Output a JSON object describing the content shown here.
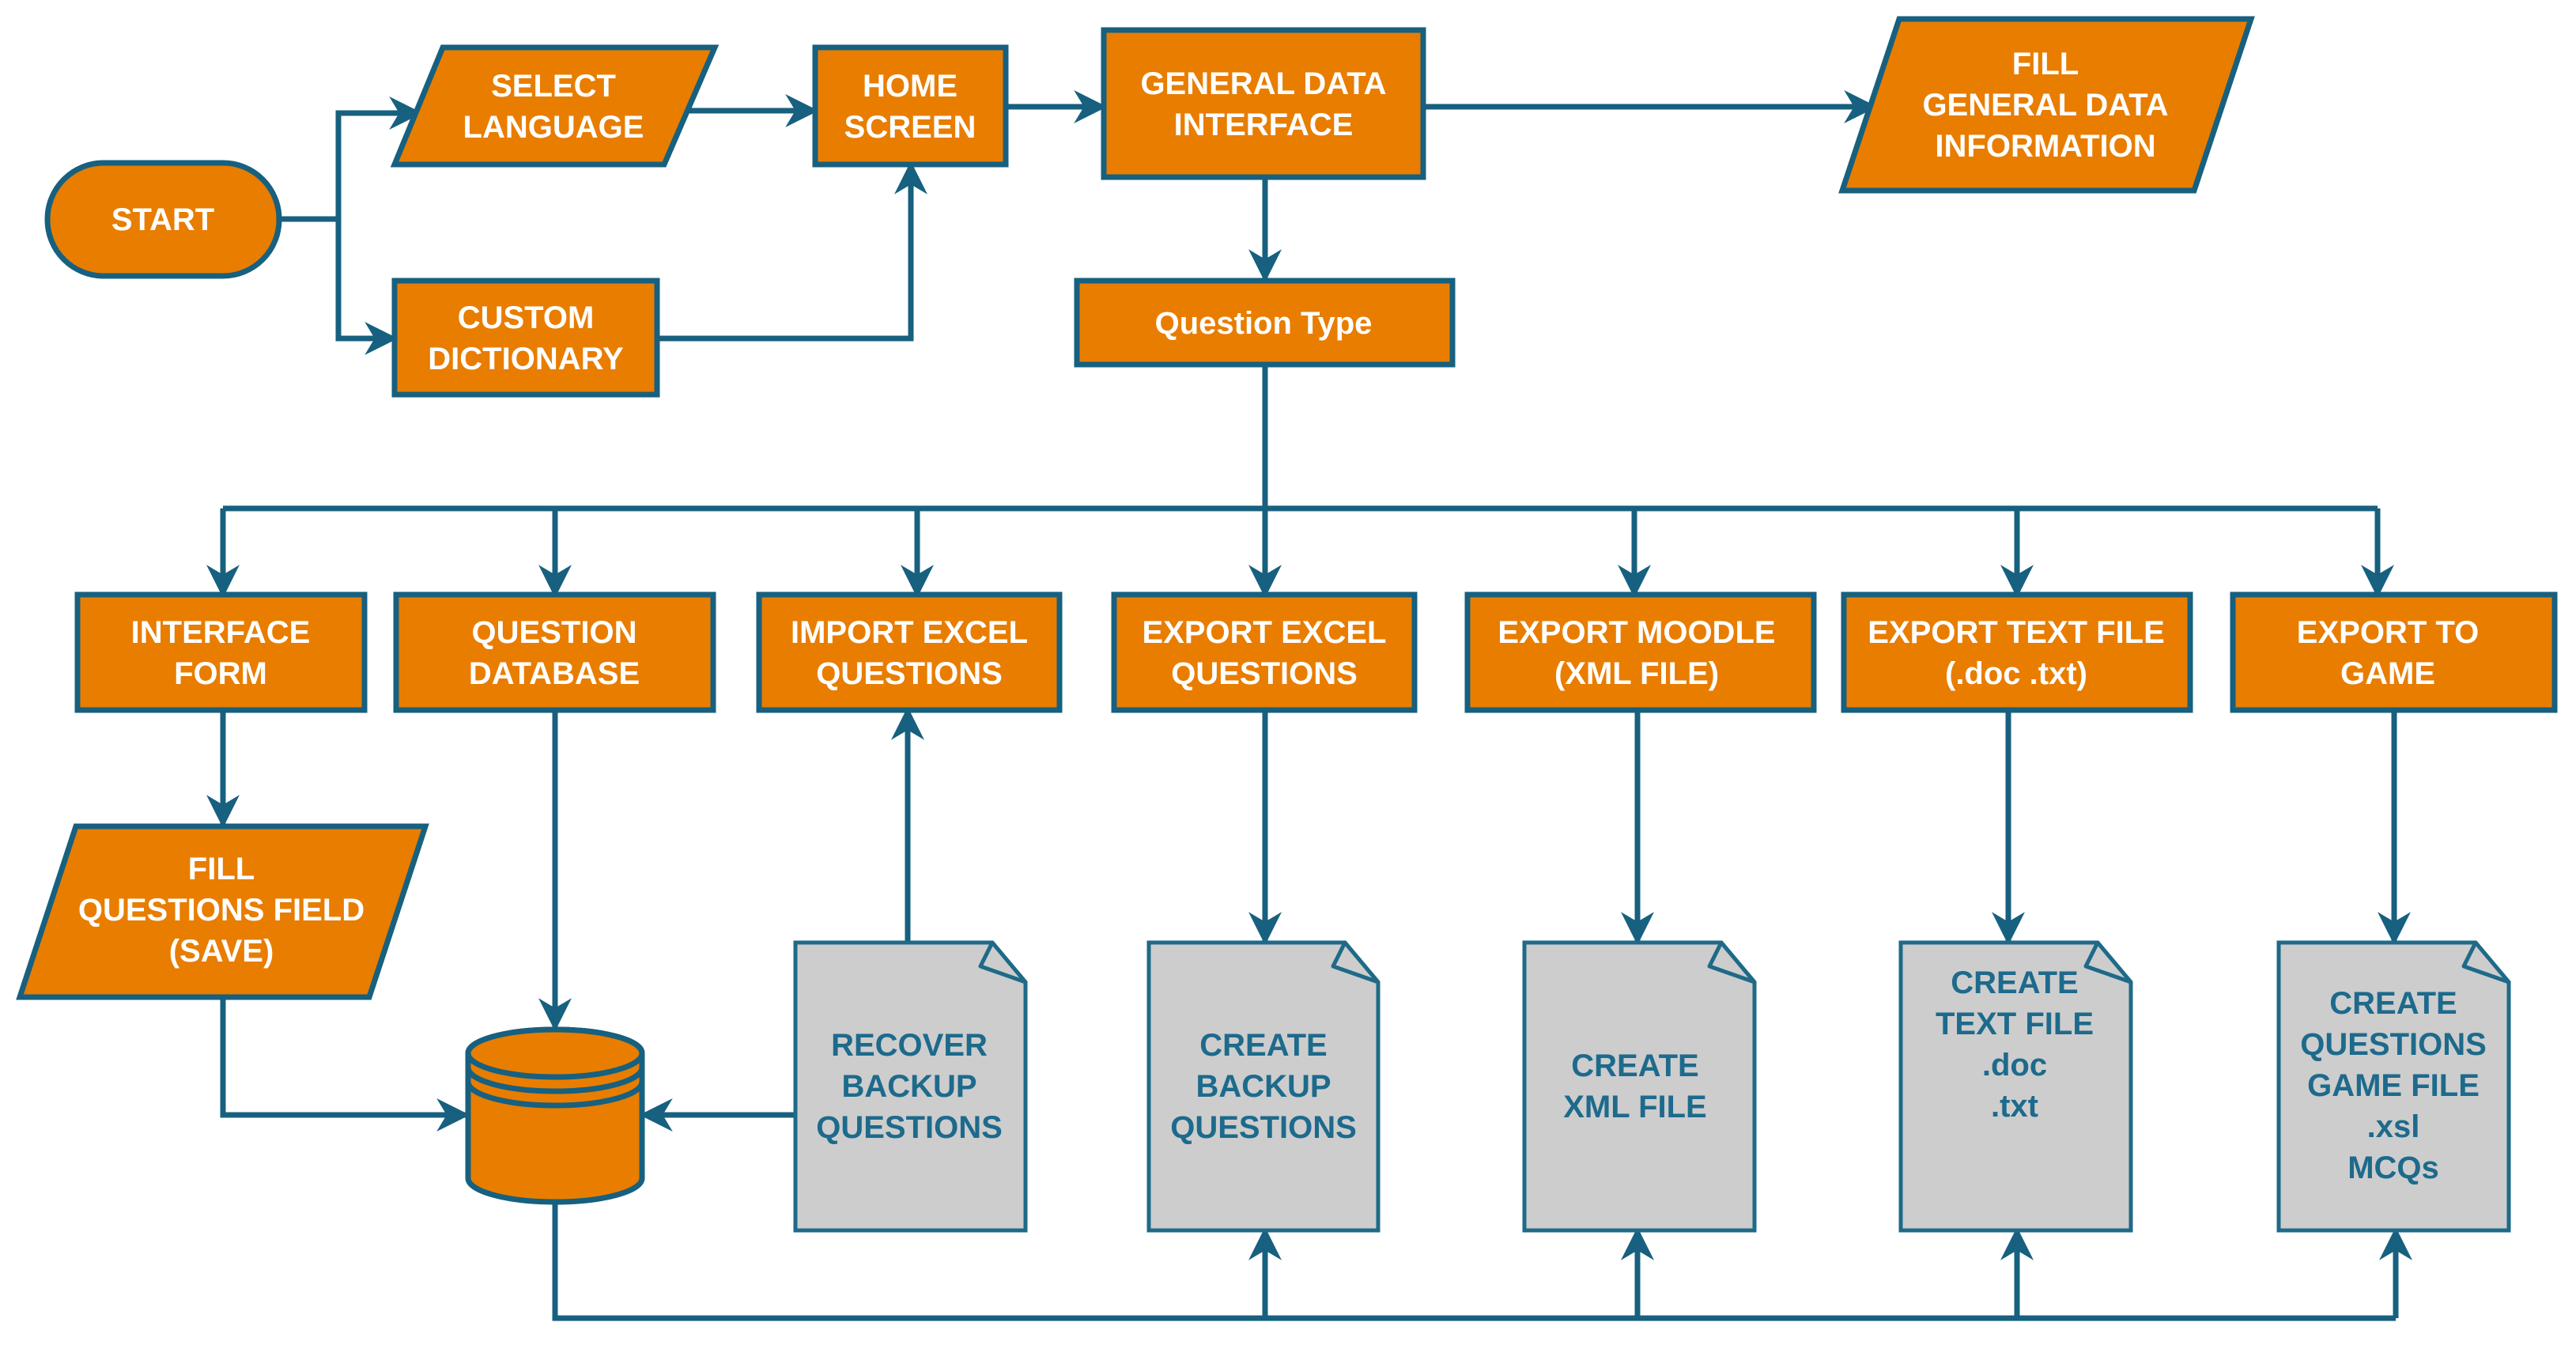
{
  "colors": {
    "process_fill": "#E87D00",
    "outline": "#17607F",
    "document_fill": "#CDCDCD",
    "document_text": "#1D6A8C",
    "process_text": "#FFFFFF"
  },
  "nodes": {
    "start": {
      "shape": "terminator",
      "lines": [
        "START"
      ]
    },
    "select_language": {
      "shape": "input-output",
      "lines": [
        "SELECT",
        "LANGUAGE"
      ]
    },
    "custom_dictionary": {
      "shape": "process",
      "lines": [
        "CUSTOM",
        "DICTIONARY"
      ]
    },
    "home_screen": {
      "shape": "process",
      "lines": [
        "HOME",
        "SCREEN"
      ]
    },
    "general_data_interface": {
      "shape": "process",
      "lines": [
        "GENERAL DATA",
        "INTERFACE"
      ]
    },
    "fill_general_data": {
      "shape": "input-output",
      "lines": [
        "FILL",
        "GENERAL DATA",
        "INFORMATION"
      ]
    },
    "question_type": {
      "shape": "process",
      "lines": [
        "Question Type"
      ]
    },
    "interface_form": {
      "shape": "process",
      "lines": [
        "INTERFACE",
        "FORM"
      ]
    },
    "question_database": {
      "shape": "process",
      "lines": [
        "QUESTION",
        "DATABASE"
      ]
    },
    "import_excel": {
      "shape": "process",
      "lines": [
        "IMPORT EXCEL",
        "QUESTIONS"
      ]
    },
    "export_excel": {
      "shape": "process",
      "lines": [
        "EXPORT EXCEL",
        "QUESTIONS"
      ]
    },
    "export_moodle": {
      "shape": "process",
      "lines": [
        "EXPORT MOODLE",
        "(XML FILE)"
      ]
    },
    "export_text": {
      "shape": "process",
      "lines": [
        "EXPORT TEXT FILE",
        "(.doc .txt)"
      ]
    },
    "export_game": {
      "shape": "process",
      "lines": [
        "EXPORT TO",
        "GAME"
      ]
    },
    "fill_questions_field": {
      "shape": "input-output",
      "lines": [
        "FILL",
        "QUESTIONS FIELD",
        "(SAVE)"
      ]
    },
    "database": {
      "shape": "database",
      "lines": []
    },
    "recover_backup": {
      "shape": "document",
      "lines": [
        "RECOVER",
        "BACKUP",
        "QUESTIONS"
      ]
    },
    "create_backup": {
      "shape": "document",
      "lines": [
        "CREATE",
        "BACKUP",
        "QUESTIONS"
      ]
    },
    "create_xml": {
      "shape": "document",
      "lines": [
        "CREATE",
        "XML FILE"
      ]
    },
    "create_text": {
      "shape": "document",
      "lines": [
        "CREATE",
        "TEXT FILE",
        ".doc",
        ".txt"
      ]
    },
    "create_game_file": {
      "shape": "document",
      "lines": [
        "CREATE",
        "QUESTIONS",
        "GAME FILE",
        ".xsl",
        "MCQs"
      ]
    }
  },
  "edges": [
    {
      "from": "start",
      "to": "select_language"
    },
    {
      "from": "start",
      "to": "custom_dictionary"
    },
    {
      "from": "select_language",
      "to": "home_screen"
    },
    {
      "from": "custom_dictionary",
      "to": "home_screen"
    },
    {
      "from": "home_screen",
      "to": "general_data_interface"
    },
    {
      "from": "general_data_interface",
      "to": "fill_general_data"
    },
    {
      "from": "general_data_interface",
      "to": "question_type"
    },
    {
      "from": "question_type",
      "to": "interface_form"
    },
    {
      "from": "question_type",
      "to": "question_database"
    },
    {
      "from": "question_type",
      "to": "import_excel"
    },
    {
      "from": "question_type",
      "to": "export_excel"
    },
    {
      "from": "question_type",
      "to": "export_moodle"
    },
    {
      "from": "question_type",
      "to": "export_text"
    },
    {
      "from": "question_type",
      "to": "export_game"
    },
    {
      "from": "interface_form",
      "to": "fill_questions_field"
    },
    {
      "from": "fill_questions_field",
      "to": "database"
    },
    {
      "from": "question_database",
      "to": "database"
    },
    {
      "from": "recover_backup",
      "to": "import_excel"
    },
    {
      "from": "recover_backup",
      "to": "database"
    },
    {
      "from": "export_excel",
      "to": "create_backup"
    },
    {
      "from": "export_moodle",
      "to": "create_xml"
    },
    {
      "from": "export_text",
      "to": "create_text"
    },
    {
      "from": "export_game",
      "to": "create_game_file"
    },
    {
      "from": "database",
      "to": "create_backup"
    },
    {
      "from": "database",
      "to": "create_xml"
    },
    {
      "from": "database",
      "to": "create_text"
    },
    {
      "from": "database",
      "to": "create_game_file"
    }
  ]
}
